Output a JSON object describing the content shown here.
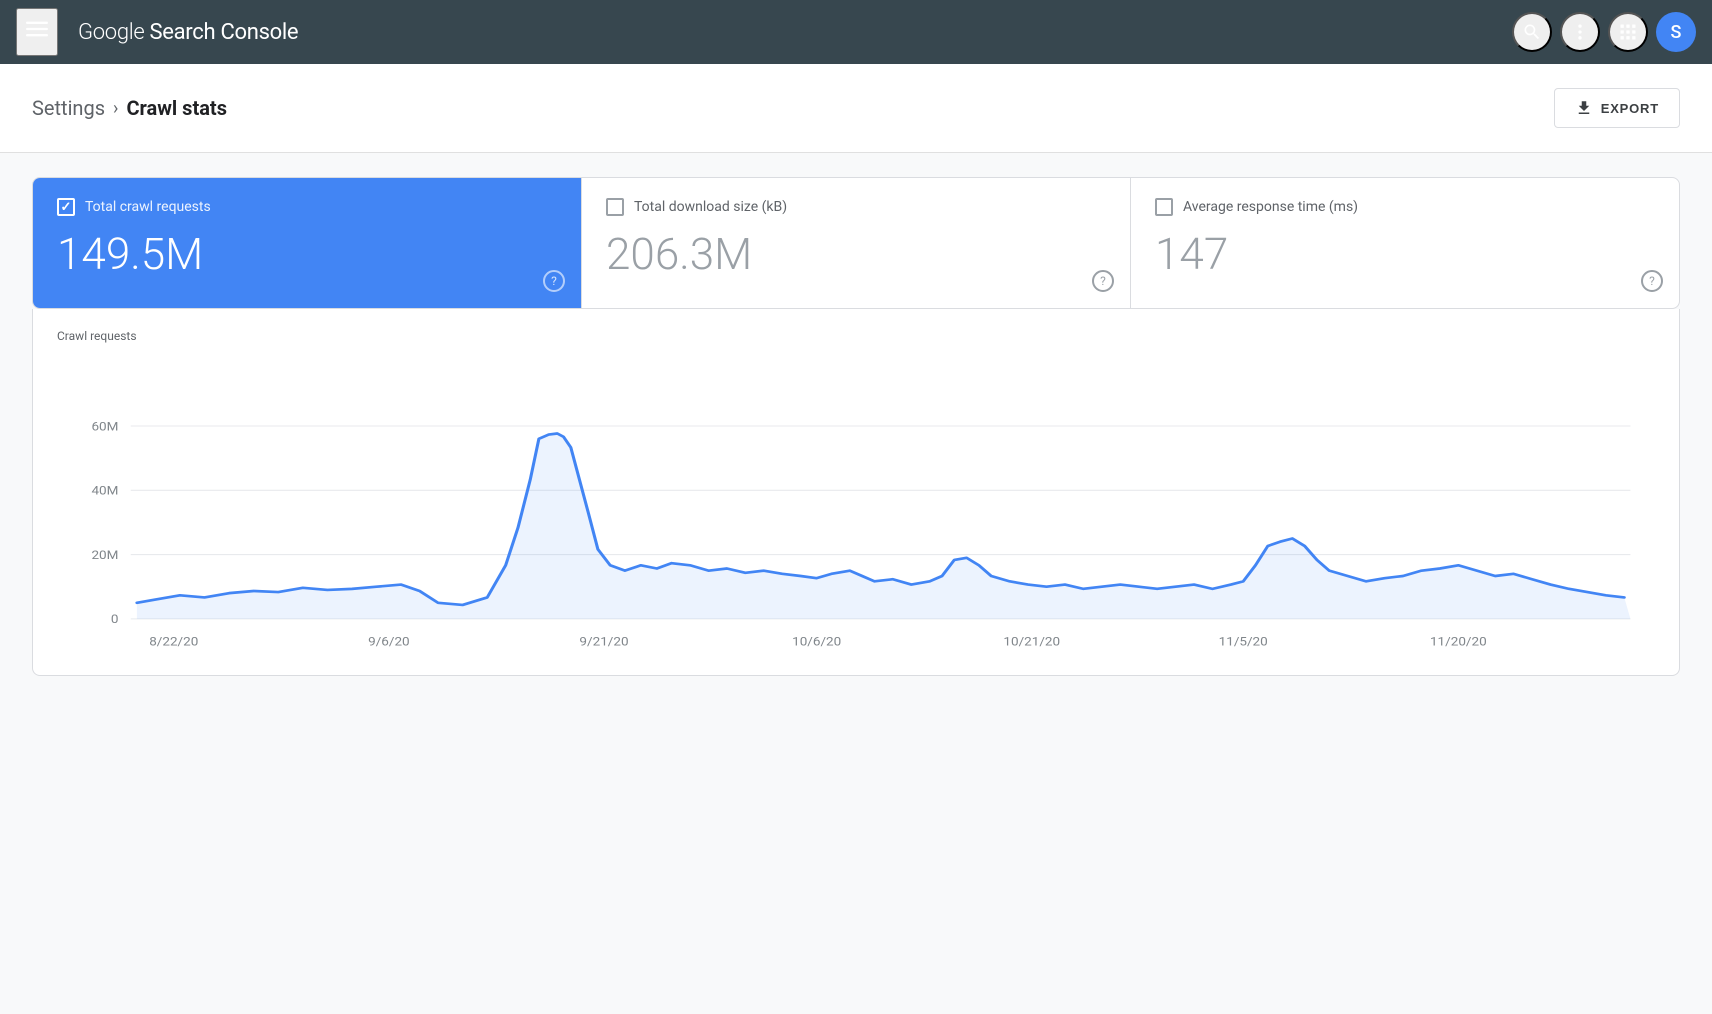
{
  "header": {
    "menu_icon": "☰",
    "title_google": "Google ",
    "title_product": "Search Console",
    "search_icon": "🔍",
    "more_icon": "⋮",
    "grid_icon": "⊞",
    "avatar_letter": "S",
    "avatar_color": "#4285f4"
  },
  "breadcrumb": {
    "settings_label": "Settings",
    "separator": "›",
    "current_label": "Crawl stats",
    "export_label": "EXPORT",
    "export_icon": "↓"
  },
  "metrics": [
    {
      "id": "crawl_requests",
      "label": "Total crawl requests",
      "value": "149.5M",
      "active": true,
      "checked": true
    },
    {
      "id": "download_size",
      "label": "Total download size (kB)",
      "value": "206.3M",
      "active": false,
      "checked": false
    },
    {
      "id": "response_time",
      "label": "Average response time (ms)",
      "value": "147",
      "active": false,
      "checked": false
    }
  ],
  "chart": {
    "y_label": "Crawl requests",
    "y_axis": [
      "60M",
      "40M",
      "20M",
      "0"
    ],
    "x_axis": [
      "8/22/20",
      "9/6/20",
      "9/21/20",
      "10/6/20",
      "10/21/20",
      "11/5/20",
      "11/20/20"
    ],
    "line_color": "#4285f4"
  }
}
